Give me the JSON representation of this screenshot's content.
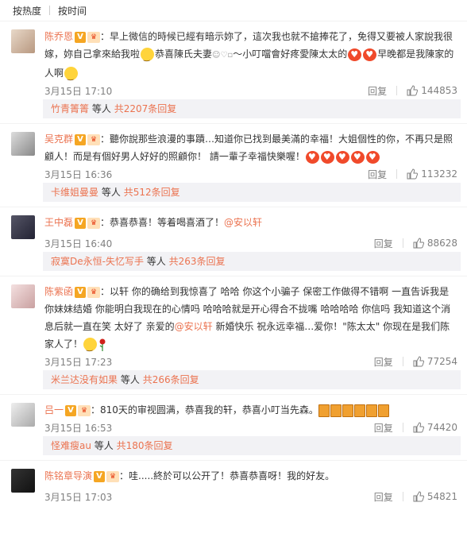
{
  "tabs": [
    "按热度",
    "按时间"
  ],
  "reply_label": "回复",
  "others_label": "等人",
  "comments": [
    {
      "user": "陈乔恩",
      "text1": "：早上微信的時候已經有暗示妳了，這次我也就不搶捧花了，免得又要被人家說我很嫁，妳自己拿來給我啦",
      "text2": "恭喜陳氏夫妻",
      "text3": "～小叮噹會好疼愛陳太太的",
      "text4": "早晚都是我陳家的人啊",
      "date": "3月15日 17:10",
      "likes": "144853",
      "sub_user": "竹青箐箐",
      "sub_count": "共2207条回复"
    },
    {
      "user": "吴克群",
      "text1": "：聽你說那些浪漫的事蹟…知道你已找到最美滿的幸福！大姐個性的你，不再只是照顧人！而是有個好男人好好的照顧你！ 請一輩子幸福快樂喔！",
      "date": "3月15日 16:36",
      "likes": "113232",
      "sub_user": "卡维姐曼曼",
      "sub_count": "共512条回复"
    },
    {
      "user": "王中磊",
      "text1": "：恭喜恭喜！等着喝喜酒了！",
      "mention": "@安以轩",
      "date": "3月15日 16:40",
      "likes": "88628",
      "sub_user": "寂寞De永恒-失忆写手",
      "sub_count": "共263条回复"
    },
    {
      "user": "陈紫函",
      "text1": "：以轩 你的确给到我惊喜了 哈哈 你这个小骗子 保密工作做得不错啊 一直告诉我是你妹妹结婚 你能明白我现在的心情吗 哈哈哈就是开心得合不拢嘴 哈哈哈哈 你信吗 我知道这个消息后就一直在笑 太好了 亲爱的",
      "mention": "@安以轩",
      "text2": " 新婚快乐 祝永远幸福…爱你！\"陈太太\" 你现在是我们陈家人了！",
      "date": "3月15日 17:23",
      "likes": "77254",
      "sub_user": "米兰达没有如果",
      "sub_count": "共266条回复"
    },
    {
      "user": "吕一",
      "text1": "：810天的审视圆满，恭喜我的轩，恭喜小叮当先森。",
      "date": "3月15日 16:53",
      "likes": "74420",
      "sub_user": "怪难瘦au",
      "sub_count": "共180条回复"
    },
    {
      "user": "陈铭章导演",
      "text1": "：哇.....終於可以公开了！恭喜恭喜呀！我的好友。",
      "date": "3月15日 17:03",
      "likes": "54821"
    }
  ],
  "colors": {
    "accent": "#eb7350",
    "badge": "#f5a623",
    "heart": "#f04a2b"
  }
}
